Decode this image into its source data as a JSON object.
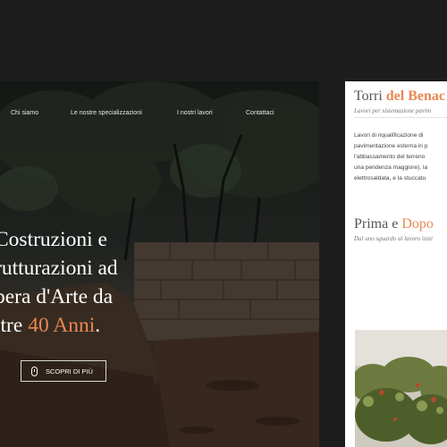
{
  "nav": {
    "items": [
      "Chi siamo",
      "Le nostre specializzazioni",
      "I nostri lavori",
      "Contattaci"
    ]
  },
  "hero": {
    "line1": "Costruzioni e",
    "line2": "rutturazioni ad",
    "line3": "pera d'Arte da",
    "line4_prefix": "ltre ",
    "line4_accent": "40 Anni",
    "line4_suffix": ".",
    "cta_label": "SCOPRI DI PIÙ"
  },
  "card": {
    "title_plain": "Torri ",
    "title_accent": "del Benac",
    "subtitle": "Lavori per sistemazione pavim",
    "paragraph": [
      "Lavori di riqualificazione di",
      "pavimentazione esterna in p",
      "l'abbassamento del terreno",
      "una pendenza maggiore), la",
      "elettrosaldata, e la stuccatu"
    ],
    "section2_plain": "Prima e ",
    "section2_accent": "Dopo",
    "section2_sub": "Dal uno sguardo al lavoro inizi"
  },
  "colors": {
    "accent": "#e98852",
    "page_background": "#1d1d1d",
    "card_background": "#ffffff"
  },
  "icons": {
    "cta_icon": "mouse-icon"
  }
}
